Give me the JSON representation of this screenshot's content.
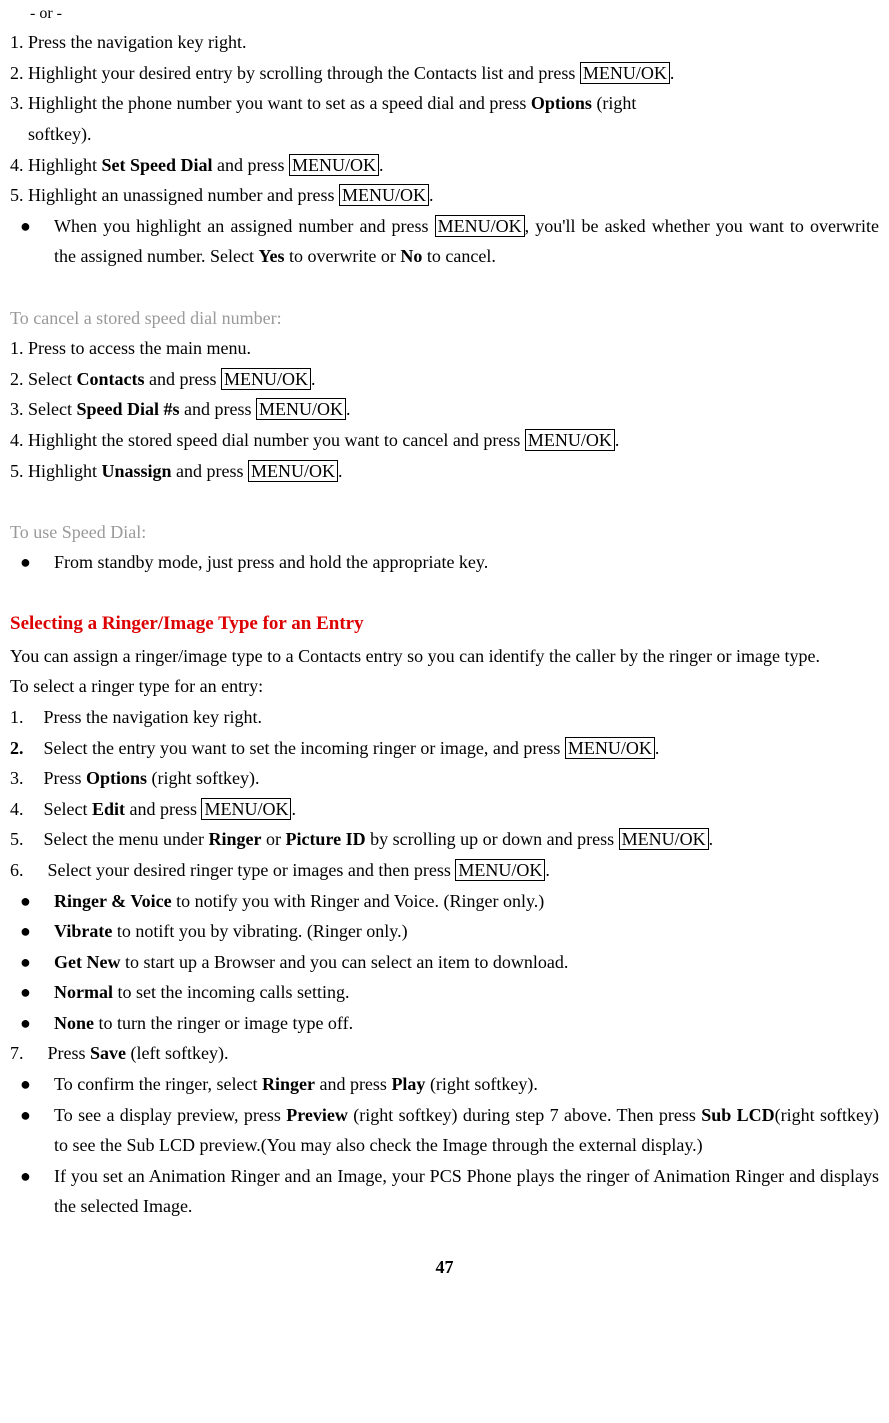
{
  "orText": "- or -",
  "block1": {
    "line1_pre": "1. Press the navigation key right.",
    "line2_pre": "2. Highlight your desired entry by scrolling through the Contacts list and press ",
    "line2_box": "MENU/OK",
    "line2_post": ".",
    "line3_pre": "3. Highlight the phone number you want to set as a speed dial and press ",
    "line3_bold": "Options",
    "line3_post": " (right",
    "line3_cont": "softkey).",
    "line4_pre": "4. Highlight ",
    "line4_bold": "Set Speed Dial",
    "line4_mid": " and press ",
    "line4_box": "MENU/OK",
    "line4_post": ".",
    "line5_pre": "5. Highlight an unassigned number and press ",
    "line5_box": "MENU/OK",
    "line5_post": ".",
    "bullet1_pre": "When you highlight an assigned number and press ",
    "bullet1_box": "MENU/OK",
    "bullet1_mid": ", you'll be asked whether you want to overwrite the assigned number. Select ",
    "bullet1_yes": "Yes",
    "bullet1_mid2": " to overwrite or ",
    "bullet1_no": "No",
    "bullet1_post": " to cancel."
  },
  "cancelHeading": "To cancel a stored speed dial number:",
  "block2": {
    "line1": "1. Press to access the main menu.",
    "line2_pre": "2. Select ",
    "line2_bold": "Contacts",
    "line2_mid": " and press ",
    "line2_box": "MENU/OK",
    "line2_post": ".",
    "line3_pre": "3. Select ",
    "line3_bold": "Speed Dial #s",
    "line3_mid": " and press ",
    "line3_box": "MENU/OK",
    "line3_post": ".",
    "line4_pre": "4. Highlight the stored speed dial number you want to cancel and press ",
    "line4_box": "MENU/OK",
    "line4_post": ".",
    "line5_pre": "5. Highlight ",
    "line5_bold": "Unassign",
    "line5_mid": " and press ",
    "line5_box": "MENU/OK",
    "line5_post": "."
  },
  "useHeading": "To use Speed Dial:",
  "useBullet": "From standby mode, just press and hold the appropriate key.",
  "redHeading": "Selecting a Ringer/Image Type for an Entry",
  "intro1": "You can assign a ringer/image type to a Contacts entry so you can identify the caller by the ringer or image type.",
  "intro2": "To select a ringer type for an entry:",
  "block3": {
    "n1": "1.",
    "t1": "Press the navigation key right.",
    "n2": "2.",
    "t2_pre": "Select the entry you want to set the incoming ringer or image, and press ",
    "t2_box": "MENU/OK",
    "t2_post": ".",
    "n3": "3.",
    "t3_pre": "Press ",
    "t3_bold": "Options",
    "t3_post": " (right softkey).",
    "n4": "4.",
    "t4_pre": "Select ",
    "t4_bold": "Edit",
    "t4_mid": " and press ",
    "t4_box": "MENU/OK",
    "t4_post": ".",
    "n5": "5.",
    "t5_pre": "Select the menu under ",
    "t5_b1": "Ringer",
    "t5_mid1": " or ",
    "t5_b2": "Picture ID",
    "t5_mid2": " by scrolling up or down and press ",
    "t5_box": "MENU/OK",
    "t5_post": ".",
    "n6": "6.",
    "t6_pre": "Select your desired ringer type or images and then press ",
    "t6_box": "MENU/OK",
    "t6_post": ".",
    "b1_bold": "Ringer & Voice",
    "b1_text": " to notify you with Ringer and Voice. (Ringer only.)",
    "b2_bold": "Vibrate",
    "b2_text": " to notift you by vibrating. (Ringer only.)",
    "b3_bold": "Get New",
    "b3_text": " to start up a Browser and you can select an item to download.",
    "b4_bold": "Normal",
    "b4_text": " to set the incoming calls setting.",
    "b5_bold": "None",
    "b5_text": " to turn the ringer or image type off.",
    "n7": "7.",
    "t7_pre": "Press ",
    "t7_bold": "Save",
    "t7_post": " (left softkey).",
    "b6_pre": "To confirm the ringer, select ",
    "b6_b1": "Ringer",
    "b6_mid": " and press ",
    "b6_b2": "Play",
    "b6_post": " (right softkey).",
    "b7_pre": "To see a display preview, press ",
    "b7_b1": "Preview",
    "b7_mid1": " (right softkey) during step 7 above. Then press ",
    "b7_b2": "Sub LCD",
    "b7_post": "(right softkey) to see the Sub LCD preview.(You may also check the Image through the external display.)",
    "b8": "If you set an Animation Ringer and an Image, your PCS Phone plays the ringer of Animation Ringer and displays the selected Image."
  },
  "pageNum": "47"
}
